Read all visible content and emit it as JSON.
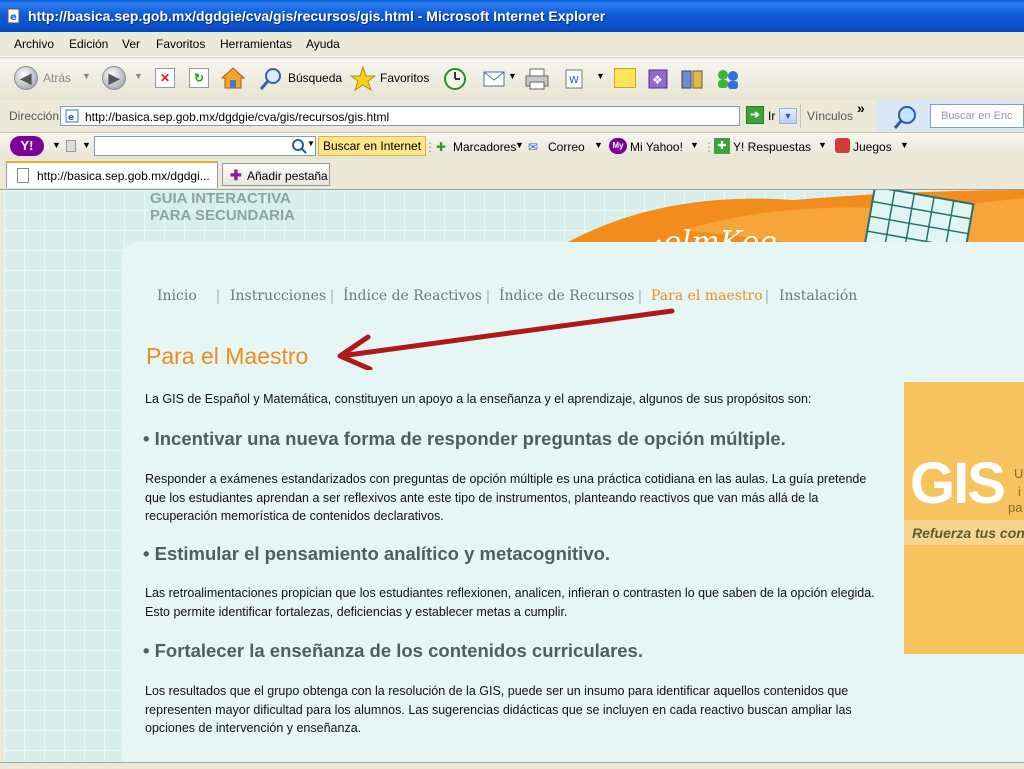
{
  "window": {
    "title": "http://basica.sep.gob.mx/dgdgie/cva/gis/recursos/gis.html - Microsoft Internet Explorer"
  },
  "menu": [
    "Archivo",
    "Edición",
    "Ver",
    "Favoritos",
    "Herramientas",
    "Ayuda"
  ],
  "toolbar": {
    "back": "Atrás",
    "search": "Búsqueda",
    "favorites": "Favoritos"
  },
  "address": {
    "label": "Dirección",
    "value": "http://basica.sep.gob.mx/dgdgie/cva/gis/recursos/gis.html",
    "go": "Ir",
    "links": "Vínculos",
    "search_placeholder": "Buscar en Enc"
  },
  "yahoo": {
    "search_button": "Buscar en Internet",
    "bookmarks": "Marcadores",
    "mail": "Correo",
    "my_yahoo": "Mi Yahoo!",
    "answers": "Y! Respuestas",
    "games": "Juegos"
  },
  "tabs": {
    "active": "http://basica.sep.gob.mx/dgdgi...",
    "add": "Añadir pestaña"
  },
  "page": {
    "header": "GUIA INTERACTIVA",
    "header2": "PARA SECUNDARIA",
    "nav": [
      "Inicio",
      "Instrucciones",
      "Índice de Reactivos",
      "Índice de Recursos",
      "Para el maestro",
      "Instalación"
    ],
    "title": "Para el Maestro",
    "intro": "La GIS de Español y Matemática, constituyen un apoyo a la enseñanza y el aprendizaje, algunos de sus propósitos son:",
    "h1": "• Incentivar una nueva forma de responder preguntas de opción múltiple.",
    "p1": "Responder a exámenes estandarizados con preguntas de opción múltiple es una práctica cotidiana en las aulas. La guía pretende que los estudiantes aprendan a ser reflexivos ante este tipo de instrumentos, planteando reactivos que van más allá de la recuperación memorística de contenidos declarativos.",
    "h2": "• Estimular el pensamiento analítico y metacognitivo.",
    "p2": "Las retroalimentaciones propician que los estudiantes reflexionen, analicen, infieran o contrasten lo que saben de la opción elegida. Esto permite identificar fortalezas, deficiencias y establecer metas a cumplir.",
    "h3": "• Fortalecer la enseñanza de los contenidos curriculares.",
    "p3": "Los resultados que el grupo obtenga con la resolución de la GIS, puede ser un insumo para identificar aquellos contenidos que representen mayor dificultad para los alumnos. Las sugerencias didácticas que se incluyen en cada reactivo buscan ampliar las opciones de intervención y enseñanza.",
    "sidebar": {
      "big": "GIS",
      "side1": "U",
      "side2": "i",
      "side3": "pa",
      "strip": "Refuerza tus con"
    }
  },
  "colors": {
    "accent": "#f08c1b",
    "arrow": "#b01818",
    "titlebar": "#0a4fc8"
  }
}
